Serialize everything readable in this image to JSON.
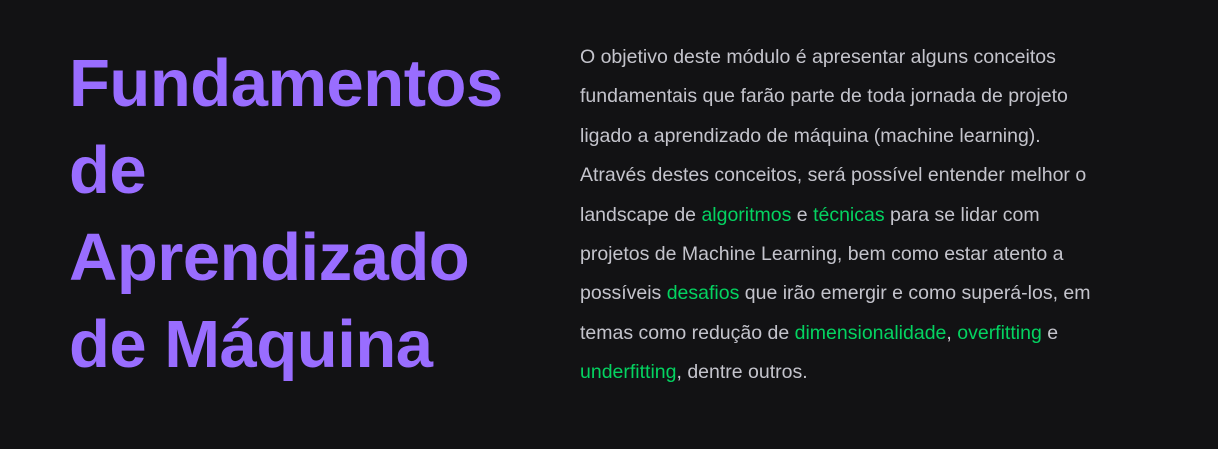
{
  "colors": {
    "background": "#121214",
    "title": "#996dff",
    "text": "#c4c4cc",
    "highlight": "#04d361"
  },
  "title": {
    "lines": [
      "Fundamentos",
      "de",
      "Aprendizado",
      "de Máquina"
    ]
  },
  "description": {
    "lines": [
      [
        {
          "text": "O objetivo deste módulo é apresentar alguns conceitos",
          "highlight": false
        }
      ],
      [
        {
          "text": "fundamentais que farão parte de toda jornada de projeto",
          "highlight": false
        }
      ],
      [
        {
          "text": "ligado a aprendizado de máquina (machine learning).",
          "highlight": false
        }
      ],
      [
        {
          "text": "Através destes conceitos, será possível entender melhor o",
          "highlight": false
        }
      ],
      [
        {
          "text": "landscape de ",
          "highlight": false
        },
        {
          "text": "algoritmos",
          "highlight": true
        },
        {
          "text": " e ",
          "highlight": false
        },
        {
          "text": "técnicas",
          "highlight": true
        },
        {
          "text": " para se lidar com",
          "highlight": false
        }
      ],
      [
        {
          "text": "projetos de Machine Learning, bem como estar atento a",
          "highlight": false
        }
      ],
      [
        {
          "text": "possíveis ",
          "highlight": false
        },
        {
          "text": "desafios",
          "highlight": true
        },
        {
          "text": " que irão emergir e como superá-los, em",
          "highlight": false
        }
      ],
      [
        {
          "text": "temas como redução de ",
          "highlight": false
        },
        {
          "text": "dimensionalidade",
          "highlight": true
        },
        {
          "text": ", ",
          "highlight": false
        },
        {
          "text": "overfitting",
          "highlight": true
        },
        {
          "text": " e",
          "highlight": false
        }
      ],
      [
        {
          "text": "underfitting",
          "highlight": true
        },
        {
          "text": ", dentre outros.",
          "highlight": false
        }
      ]
    ]
  }
}
